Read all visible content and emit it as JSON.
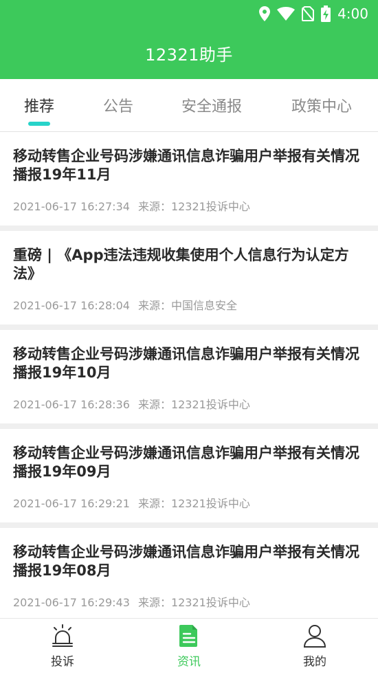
{
  "status_bar": {
    "time": "4:00"
  },
  "header": {
    "title": "12321助手"
  },
  "tabs": [
    {
      "label": "推荐",
      "active": true
    },
    {
      "label": "公告",
      "active": false
    },
    {
      "label": "安全通报",
      "active": false
    },
    {
      "label": "政策中心",
      "active": false
    }
  ],
  "articles": [
    {
      "title": "移动转售企业号码涉嫌通讯信息诈骗用户举报有关情况播报19年11月",
      "datetime": "2021-06-17 16:27:34",
      "source": "来源：12321投诉中心"
    },
    {
      "title": "重磅 | 《App违法违规收集使用个人信息行为认定方法》",
      "datetime": "2021-06-17 16:28:04",
      "source": "来源：中国信息安全"
    },
    {
      "title": "移动转售企业号码涉嫌通讯信息诈骗用户举报有关情况播报19年10月",
      "datetime": "2021-06-17 16:28:36",
      "source": "来源：12321投诉中心"
    },
    {
      "title": "移动转售企业号码涉嫌通讯信息诈骗用户举报有关情况播报19年09月",
      "datetime": "2021-06-17 16:29:21",
      "source": "来源：12321投诉中心"
    },
    {
      "title": "移动转售企业号码涉嫌通讯信息诈骗用户举报有关情况播报19年08月",
      "datetime": "2021-06-17 16:29:43",
      "source": "来源：12321投诉中心"
    }
  ],
  "bottom_nav": [
    {
      "label": "投诉",
      "icon": "alarm-icon",
      "active": false
    },
    {
      "label": "资讯",
      "icon": "news-document-icon",
      "active": true
    },
    {
      "label": "我的",
      "icon": "person-icon",
      "active": false
    }
  ],
  "colors": {
    "primary_green": "#3dc95b",
    "tab_indicator": "#27d3c9"
  }
}
